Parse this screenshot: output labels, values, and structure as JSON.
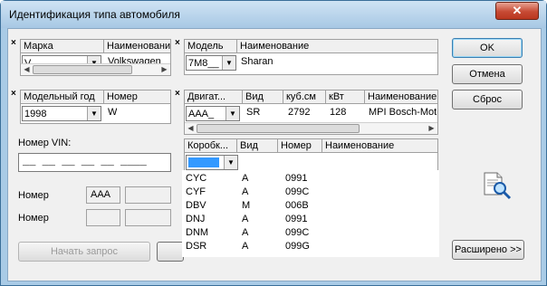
{
  "window": {
    "title": "Идентификация типа автомобиля",
    "close_glyph": "✕"
  },
  "mark_glyph": "×",
  "make_grid": {
    "headers": [
      "Марка",
      "Наименование"
    ],
    "value": "V",
    "name": "Volkswagen"
  },
  "model_grid": {
    "headers": [
      "Модель",
      "Наименование"
    ],
    "value": "7M8__",
    "name": "Sharan"
  },
  "year_grid": {
    "headers": [
      "Модельный год",
      "Номер"
    ],
    "value": "1998",
    "number": "W"
  },
  "engine_grid": {
    "headers": [
      "Двигат...",
      "Вид",
      "куб.см",
      "кВт",
      "Наименование"
    ],
    "value": "AAA_",
    "type": "SR",
    "ccm": "2792",
    "kw": "128",
    "name": "MPI Bosch-Mot"
  },
  "gearbox_grid": {
    "headers": [
      "Коробк...",
      "Вид",
      "Номер",
      "Наименование"
    ],
    "value": ""
  },
  "vin": {
    "label": "Номер VIN:",
    "value": "__ __ __ __ __ ____"
  },
  "number_row1": {
    "label": "Номер",
    "value": "AAA"
  },
  "number_row2": {
    "label": "Номер"
  },
  "buttons": {
    "ok": "OK",
    "cancel": "Отмена",
    "reset": "Сброс",
    "start": "Начать запрос",
    "extended": "Расширено >>"
  },
  "gearbox_list": [
    {
      "code": "CYC",
      "type": "A",
      "number": "0991"
    },
    {
      "code": "CYF",
      "type": "A",
      "number": "099C"
    },
    {
      "code": "DBV",
      "type": "M",
      "number": "006B"
    },
    {
      "code": "DNJ",
      "type": "A",
      "number": "0991"
    },
    {
      "code": "DNM",
      "type": "A",
      "number": "099C"
    },
    {
      "code": "DSR",
      "type": "A",
      "number": "099G"
    }
  ]
}
